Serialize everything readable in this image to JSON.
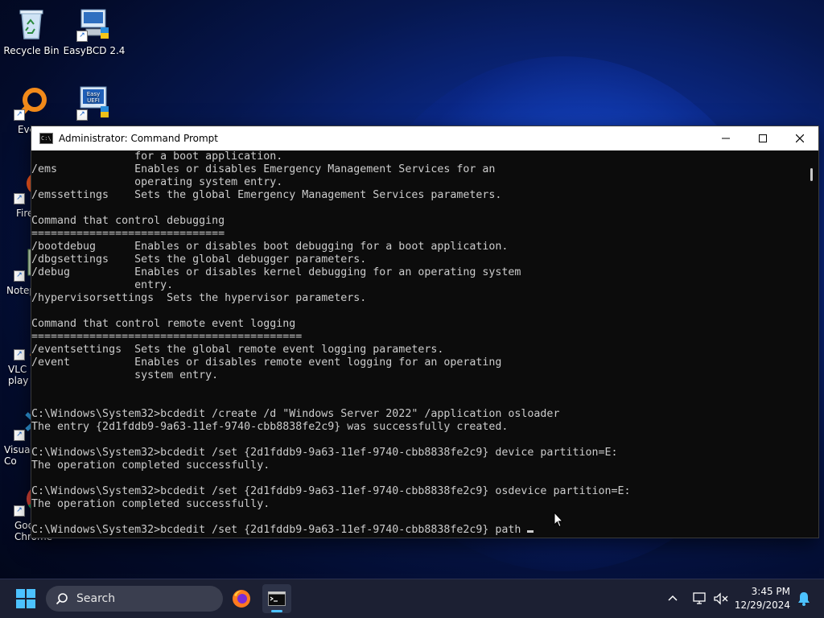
{
  "desktop": {
    "icons": [
      {
        "label": "Recycle Bin"
      },
      {
        "label": "EasyBCD 2.4"
      },
      {
        "label": "Every"
      },
      {
        "label": "Easy UEFI",
        "icon_text": "Easy UEFI"
      },
      {
        "label": "Fire"
      },
      {
        "label": "Notep"
      },
      {
        "label": "VLC r\nplay"
      },
      {
        "label": "Visual\nCo"
      },
      {
        "label": "Goo\nChrome"
      }
    ]
  },
  "window": {
    "title": "Administrator: Command Prompt",
    "icon_text": "C:\\",
    "console_lines": [
      "                for a boot application.",
      "/ems            Enables or disables Emergency Management Services for an",
      "                operating system entry.",
      "/emssettings    Sets the global Emergency Management Services parameters.",
      "",
      "Command that control debugging",
      "==============================",
      "/bootdebug      Enables or disables boot debugging for a boot application.",
      "/dbgsettings    Sets the global debugger parameters.",
      "/debug          Enables or disables kernel debugging for an operating system",
      "                entry.",
      "/hypervisorsettings  Sets the hypervisor parameters.",
      "",
      "Command that control remote event logging",
      "==========================================",
      "/eventsettings  Sets the global remote event logging parameters.",
      "/event          Enables or disables remote event logging for an operating",
      "                system entry.",
      "",
      "",
      "C:\\Windows\\System32>bcdedit /create /d \"Windows Server 2022\" /application osloader",
      "The entry {2d1fddb9-9a63-11ef-9740-cbb8838fe2c9} was successfully created.",
      "",
      "C:\\Windows\\System32>bcdedit /set {2d1fddb9-9a63-11ef-9740-cbb8838fe2c9} device partition=E:",
      "The operation completed successfully.",
      "",
      "C:\\Windows\\System32>bcdedit /set {2d1fddb9-9a63-11ef-9740-cbb8838fe2c9} osdevice partition=E:",
      "The operation completed successfully.",
      ""
    ],
    "prompt_line": "C:\\Windows\\System32>bcdedit /set {2d1fddb9-9a63-11ef-9740-cbb8838fe2c9} path "
  },
  "taskbar": {
    "search_label": "Search",
    "time": "3:45 PM",
    "date": "12/29/2024",
    "accent": "#4cc2ff"
  }
}
